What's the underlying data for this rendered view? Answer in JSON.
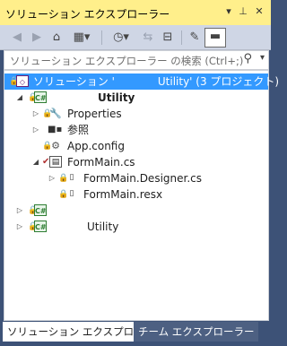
{
  "window": {
    "title": "ソリューション エクスプローラー",
    "buttons": {
      "dropdown": "▾",
      "pin": "⊥",
      "close": "✕"
    }
  },
  "toolbar": {
    "back": "◀",
    "forward": "▶",
    "home": "⌂",
    "switch_view": "▦▾",
    "pending": "◷▾",
    "sync": "⇆",
    "collapse": "⊟",
    "properties": "✎",
    "preview": "▬"
  },
  "search": {
    "placeholder": "ソリューション エクスプローラー の検索 (Ctrl+;)",
    "icon": "⚲",
    "dropdown": "▾"
  },
  "tree": {
    "solution_label": "ソリューション '　　　　Utility' (3 プロジェクト)",
    "project1_name": "Utility",
    "properties": "Properties",
    "references": "参照",
    "app_config": "App.config",
    "formmain": "FormMain.cs",
    "formmain_designer": "FormMain.Designer.cs",
    "formmain_resx": "FormMain.resx",
    "project2_name": "",
    "project3_name": "Utility"
  },
  "tabs": [
    {
      "label": "ソリューション エクスプローラー",
      "active": true
    },
    {
      "label": "チーム エクスプローラー",
      "active": false
    }
  ],
  "colors": {
    "title_bg": "#ffef8b",
    "toolbar_bg": "#cfd6e5",
    "selected_bg": "#3399ff",
    "frame_bg": "#3d5277"
  }
}
